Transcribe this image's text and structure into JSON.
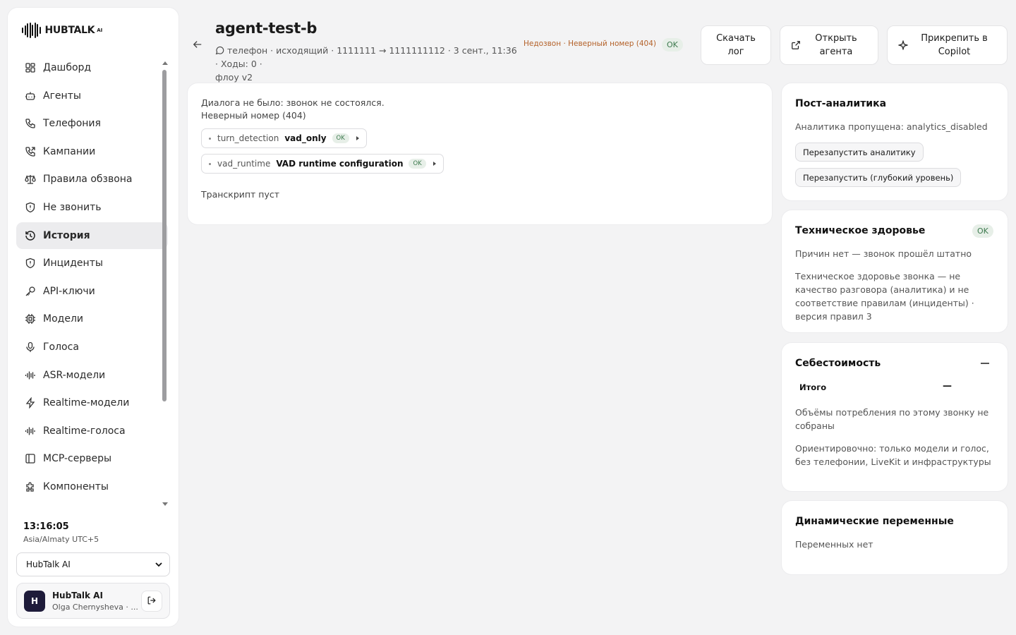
{
  "brand": {
    "name": "HUBTALK",
    "suffix": "AI"
  },
  "sidebar": {
    "items": [
      {
        "label": "Дашборд",
        "icon": "dashboard-icon",
        "active": false
      },
      {
        "label": "Агенты",
        "icon": "bot-icon",
        "active": false
      },
      {
        "label": "Телефония",
        "icon": "phone-icon",
        "active": false
      },
      {
        "label": "Кампании",
        "icon": "phone-outgoing-icon",
        "active": false
      },
      {
        "label": "Правила обзвона",
        "icon": "scale-icon",
        "active": false
      },
      {
        "label": "Не звонить",
        "icon": "shield-icon",
        "active": false
      },
      {
        "label": "История",
        "icon": "history-icon",
        "active": true
      },
      {
        "label": "Инциденты",
        "icon": "shield-alert-icon",
        "active": false
      },
      {
        "label": "API-ключи",
        "icon": "key-icon",
        "active": false
      },
      {
        "label": "Модели",
        "icon": "cpu-icon",
        "active": false
      },
      {
        "label": "Голоса",
        "icon": "mic-icon",
        "active": false
      },
      {
        "label": "ASR-модели",
        "icon": "audio-lines-icon",
        "active": false
      },
      {
        "label": "Realtime-модели",
        "icon": "zap-icon",
        "active": false
      },
      {
        "label": "Realtime-голоса",
        "icon": "audio-lines-icon",
        "active": false
      },
      {
        "label": "MCP-серверы",
        "icon": "panel-icon",
        "active": false
      },
      {
        "label": "Компоненты",
        "icon": "puzzle-icon",
        "active": false
      }
    ],
    "clock": "13:16:05",
    "timezone": "Asia/Almaty UTC+5",
    "org_selected": "HubTalk AI",
    "user": {
      "initial": "H",
      "name": "HubTalk AI",
      "subtitle": "Olga Chernysheva · ..."
    }
  },
  "header": {
    "title": "agent-test-b",
    "meta_line1": "телефон · исходящий · 1111111 → 1111111112 · 3 сент., 11:36 · Ходы: 0 ·",
    "meta_line2": "флоу v2",
    "status_text": "Недозвон · Неверный номер (404)",
    "status_badge": "OK",
    "download_label_1": "Скачать",
    "download_label_2": "лог",
    "open_label_1": "Открыть",
    "open_label_2": "агента",
    "pin_label_1": "Прикрепить в",
    "pin_label_2": "Copilot"
  },
  "main": {
    "message_line1": "Диалога не было: звонок не состоялся.",
    "message_line2": "Неверный номер (404)",
    "chips": [
      {
        "key": "turn_detection",
        "value": "vad_only",
        "badge": "OK"
      },
      {
        "key": "vad_runtime",
        "value": "VAD runtime configuration",
        "badge": "OK"
      }
    ],
    "transcript_empty": "Транскрипт пуст"
  },
  "analytics": {
    "title": "Пост-аналитика",
    "text": "Аналитика пропущена: analytics_disabled",
    "rerun_label": "Перезапустить аналитику",
    "rerun_deep_label": "Перезапустить (глубокий уровень)"
  },
  "health": {
    "title": "Техническое здоровье",
    "badge": "OK",
    "text1": "Причин нет — звонок прошёл штатно",
    "text2": "Техническое здоровье звонка — не качество разговора (аналитика) и не соответствие правилам (инциденты) · версия правил 3"
  },
  "cost": {
    "title": "Себестоимость",
    "total_label": "Итого",
    "total_value": "—",
    "text1": "Объёмы потребления по этому звонку не собраны",
    "text2": "Ориентировочно: только модели и голос, без телефонии, LiveKit и инфраструктуры"
  },
  "vars": {
    "title": "Динамические переменные",
    "text": "Переменных нет"
  },
  "colors": {
    "accent_warning": "#b4622a",
    "ok_bg": "#e7efe8",
    "ok_text": "#3d7a4e",
    "avatar_bg": "#1e1b3a"
  }
}
